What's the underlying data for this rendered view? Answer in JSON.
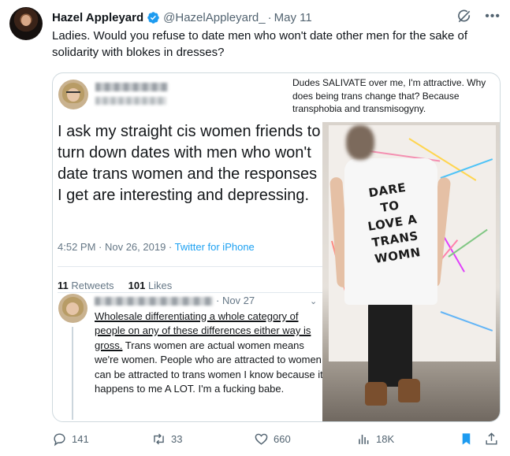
{
  "post": {
    "author_name": "Hazel Appleyard",
    "handle": "@HazelAppleyard_",
    "separator": "·",
    "date": "May 11",
    "text": "Ladies. Would you refuse to date men who won't date other men for the sake of solidarity with blokes in dresses?"
  },
  "embedded_tweet": {
    "text": "I ask my straight cis women friends to turn down dates with men who won't date trans women and the responses I get are interesting and depressing.",
    "time": "4:52 PM · Nov 26, 2019 · ",
    "source": "Twitter for iPhone",
    "retweets_count": "11",
    "retweets_label": " Retweets",
    "likes_count": "101",
    "likes_label": " Likes"
  },
  "reply": {
    "date": "· Nov 27",
    "underlined_text": "Wholesale differentiating a whole category of people on any of these differences either way is gross.",
    "rest_text": " Trans women are actual women means we're women. People who are attracted to women can be attracted to trans women I know because it happens to me A LOT. I'm a fucking babe."
  },
  "photo": {
    "caption": "Dudes SALIVATE over me, I'm attractive. Why does being trans change that? Because transphobia and transmisogyny.",
    "shirt_lines": [
      "DARE",
      "TO",
      "LOVE A",
      "TRANS",
      "WOMN"
    ]
  },
  "actions": {
    "replies": "141",
    "reposts": "33",
    "likes": "660",
    "views": "18K"
  },
  "colors": {
    "verified_blue": "#1d9bf0",
    "bookmark_blue": "#1d9bf0",
    "muted": "#536471"
  },
  "icons": [
    "verified-badge-icon",
    "grok-icon",
    "more-icon",
    "reply-icon",
    "repost-icon",
    "like-icon",
    "views-icon",
    "bookmark-icon",
    "share-icon"
  ]
}
